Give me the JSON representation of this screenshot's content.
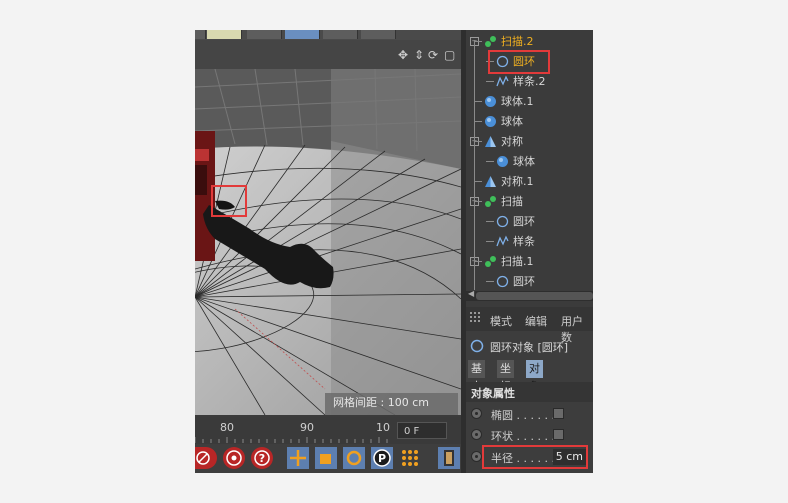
{
  "viewport": {
    "grid_spacing_label": "网格间距 : 100 cm"
  },
  "timeline": {
    "ticks": [
      "80",
      "90",
      "10"
    ],
    "frame_value": "0 F"
  },
  "object_manager": {
    "items": [
      {
        "label": "扫描.2",
        "icon": "sweep-icon",
        "indent": 1,
        "expander": "−",
        "active": true
      },
      {
        "label": "圆环",
        "icon": "circle-spline-icon",
        "indent": 2,
        "selected": true
      },
      {
        "label": "样条.2",
        "icon": "spline-icon",
        "indent": 2
      },
      {
        "label": "球体.1",
        "icon": "sphere-icon",
        "indent": 1
      },
      {
        "label": "球体",
        "icon": "sphere-icon",
        "indent": 1
      },
      {
        "label": "对称",
        "icon": "symmetry-icon",
        "indent": 1,
        "expander": "−"
      },
      {
        "label": "球体",
        "icon": "sphere-icon",
        "indent": 2
      },
      {
        "label": "对称.1",
        "icon": "symmetry-icon",
        "indent": 1
      },
      {
        "label": "扫描",
        "icon": "sweep-icon",
        "indent": 1,
        "expander": "−"
      },
      {
        "label": "圆环",
        "icon": "circle-spline-icon",
        "indent": 2
      },
      {
        "label": "样条",
        "icon": "spline-icon",
        "indent": 2
      },
      {
        "label": "扫描.1",
        "icon": "sweep-icon",
        "indent": 1,
        "expander": "−"
      },
      {
        "label": "圆环",
        "icon": "circle-spline-icon",
        "indent": 2
      }
    ]
  },
  "attributes": {
    "menu": [
      "模式",
      "编辑",
      "用户数"
    ],
    "object_title": "圆环对象 [圆环]",
    "tabs": [
      "基本",
      "坐标",
      "对象"
    ],
    "active_tab": "对象",
    "section": "对象属性",
    "props": [
      {
        "label": "椭圆 . . . . . .",
        "kind": "checkbox"
      },
      {
        "label": "环状 . . . . . .",
        "kind": "checkbox"
      },
      {
        "label": "半径 . . . . . .",
        "kind": "value",
        "value": "5 cm"
      }
    ]
  },
  "colors": {
    "highlight": "#e23a3a",
    "selected_text": "#f0b020",
    "active_tab": "#8da8c8"
  }
}
